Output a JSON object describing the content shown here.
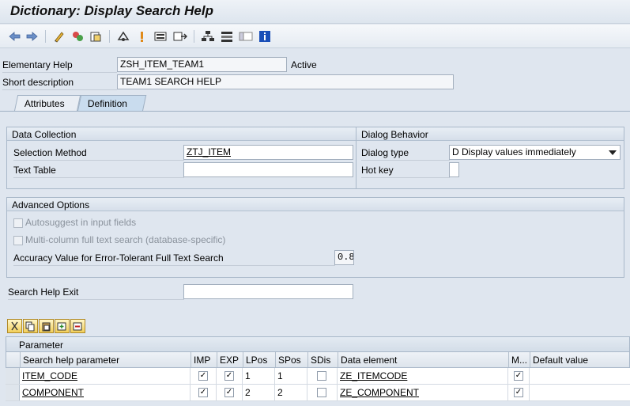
{
  "window": {
    "title": "Dictionary: Display Search Help"
  },
  "toolbar": {
    "icons": [
      "back-arrow-icon",
      "forward-arrow-icon",
      "display-change-icon",
      "activate-icon",
      "other-object-icon",
      "where-used-icon",
      "check-icon",
      "display-object-list-icon",
      "navigation-icon",
      "hierarchy-icon",
      "input-help-icon",
      "layout-icon",
      "info-icon"
    ]
  },
  "header": {
    "elementary_help_label": "Elementary Help",
    "elementary_help_value": "ZSH_ITEM_TEAM1",
    "status": "Active",
    "short_desc_label": "Short description",
    "short_desc_value": "TEAM1 SEARCH HELP"
  },
  "tabs": [
    {
      "label": "Attributes",
      "active": false
    },
    {
      "label": "Definition",
      "active": true
    }
  ],
  "data_collection": {
    "title": "Data Collection",
    "selection_method_label": "Selection Method",
    "selection_method_value": "ZTJ_ITEM",
    "text_table_label": "Text Table",
    "text_table_value": ""
  },
  "dialog_behavior": {
    "title": "Dialog Behavior",
    "dialog_type_label": "Dialog type",
    "dialog_type_value": "D Display values immediately",
    "hot_key_label": "Hot key",
    "hot_key_value": ""
  },
  "advanced_options": {
    "title": "Advanced Options",
    "autosuggest_label": "Autosuggest in input fields",
    "multicolumn_label": "Multi-column full text search (database-specific)",
    "accuracy_label": "Accuracy Value for Error-Tolerant Full Text Search",
    "accuracy_value": "0.8"
  },
  "search_help_exit": {
    "label": "Search Help Exit",
    "value": ""
  },
  "parameter_table": {
    "title": "Parameter",
    "columns": [
      "Search help parameter",
      "IMP",
      "EXP",
      "LPos",
      "SPos",
      "SDis",
      "Data element",
      "M...",
      "Default value"
    ],
    "rows": [
      {
        "param": "ITEM_CODE",
        "imp": true,
        "exp": true,
        "lpos": "1",
        "spos": "1",
        "sdis": false,
        "data_element": "ZE_ITEMCODE",
        "m": true,
        "default": ""
      },
      {
        "param": "COMPONENT",
        "imp": true,
        "exp": true,
        "lpos": "2",
        "spos": "2",
        "sdis": false,
        "data_element": "ZE_COMPONENT",
        "m": true,
        "default": ""
      }
    ]
  }
}
